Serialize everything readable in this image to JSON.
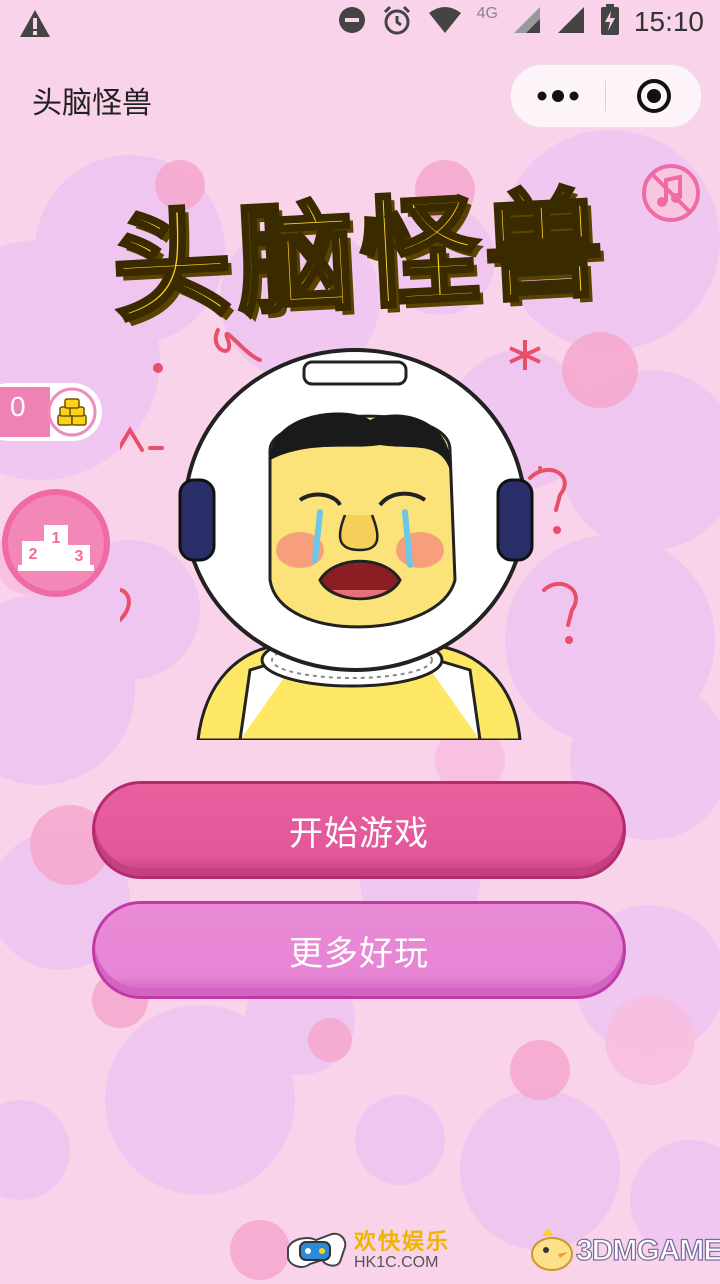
{
  "status_bar": {
    "time": "15:10",
    "network_label": "4G",
    "icons": [
      "warning-icon",
      "do-not-disturb-icon",
      "alarm-icon",
      "wifi-icon",
      "signal-icon",
      "signal-icon",
      "battery-charging-icon"
    ]
  },
  "nav": {
    "title": "头脑怪兽",
    "more_icon": "more-dots-icon",
    "close_icon": "target-close-icon"
  },
  "game": {
    "title": "头脑怪兽",
    "coins": "0",
    "mute_icon": "music-muted-icon",
    "rank_icon": "podium-icon",
    "coin_icon": "coins-icon"
  },
  "buttons": {
    "start": "开始游戏",
    "more": "更多好玩"
  },
  "watermarks": {
    "left_name": "欢快娱乐",
    "left_url": "HK1C.COM",
    "right_text": "3DMGAME"
  },
  "colors": {
    "background": "#f9d3ea",
    "start_button": "#e25799",
    "more_button": "#e585d4",
    "title_yellow": "#ffd21a"
  }
}
